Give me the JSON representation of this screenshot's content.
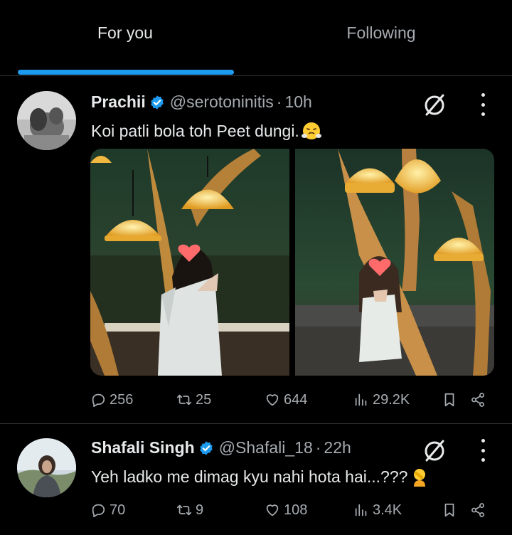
{
  "tabs": [
    {
      "label": "For you",
      "active": true
    },
    {
      "label": "Following",
      "active": false
    }
  ],
  "accent_color": "#1d9bf0",
  "posts": [
    {
      "name": "Prachii",
      "handle": "@serotoninitis",
      "separator": "·",
      "time": "10h",
      "text": "Koi patli bola toh Peet dungi.",
      "emoji": "face-with-steam-emoji",
      "media_count": 2,
      "stats": {
        "replies": "256",
        "reposts": "25",
        "likes": "644",
        "views": "29.2K"
      }
    },
    {
      "name": "Shafali Singh",
      "handle": "@Shafali_18",
      "separator": "·",
      "time": "22h",
      "text": "Yeh ladko me dimag kyu nahi hota hai...???",
      "emoji": "person-facepalming-emoji",
      "media_count": 0,
      "stats": {
        "replies": "70",
        "reposts": "9",
        "likes": "108",
        "views": "3.4K"
      }
    }
  ]
}
